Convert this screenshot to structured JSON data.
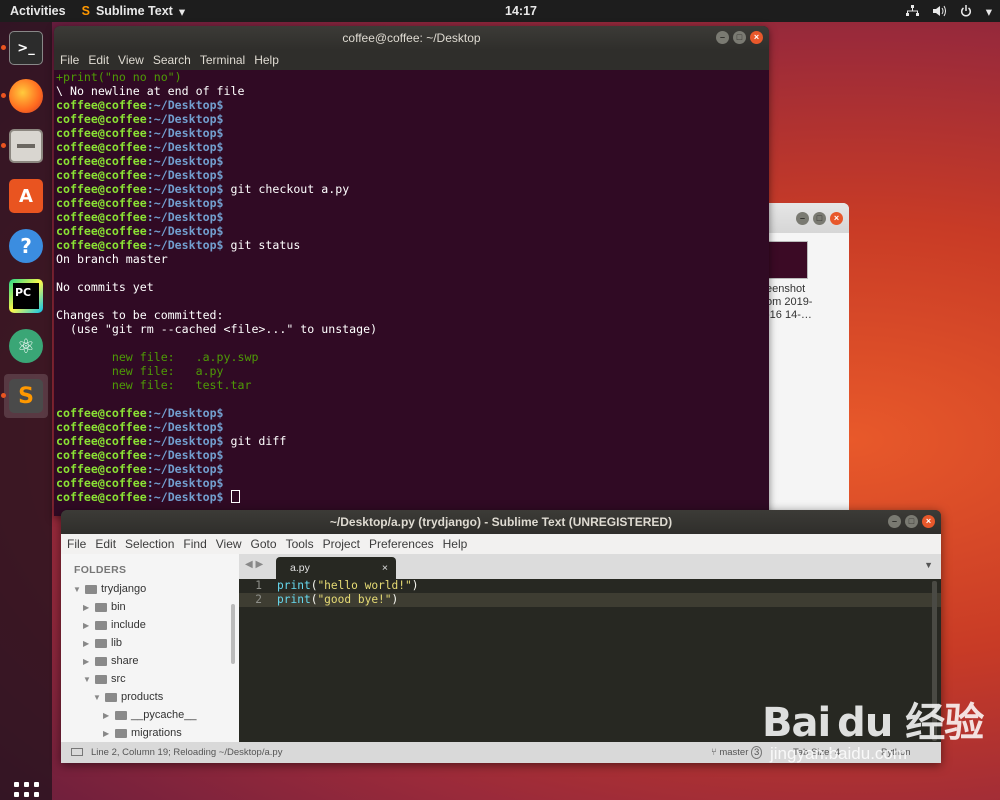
{
  "topbar": {
    "activities": "Activities",
    "app_name": "Sublime Text",
    "app_menu_arrow": "▾",
    "clock": "14:17"
  },
  "dock": {
    "items": [
      {
        "name": "terminal",
        "icon": "terminal-icon",
        "active": false,
        "running": true
      },
      {
        "name": "firefox",
        "icon": "firefox-icon",
        "active": false,
        "running": true
      },
      {
        "name": "files",
        "icon": "files-icon",
        "active": false,
        "running": true
      },
      {
        "name": "software",
        "icon": "ubuntu-software-icon",
        "active": false,
        "running": false
      },
      {
        "name": "help",
        "icon": "help-icon",
        "active": false,
        "running": false
      },
      {
        "name": "pycharm",
        "icon": "pycharm-icon",
        "active": false,
        "running": false
      },
      {
        "name": "atom",
        "icon": "atom-icon",
        "active": false,
        "running": false
      },
      {
        "name": "sublime",
        "icon": "sublime-text-icon",
        "active": true,
        "running": true
      }
    ]
  },
  "terminal": {
    "title": "coffee@coffee: ~/Desktop",
    "menu": [
      "File",
      "Edit",
      "View",
      "Search",
      "Terminal",
      "Help"
    ],
    "prompt_user": "coffee@coffee",
    "prompt_path": ":~/Desktop",
    "prompt_end": "$",
    "lines": [
      {
        "type": "diffadd",
        "text": "+print(\"no no no\")"
      },
      {
        "type": "text",
        "text": "\\ No newline at end of file"
      },
      {
        "type": "prompt",
        "cmd": ""
      },
      {
        "type": "prompt",
        "cmd": ""
      },
      {
        "type": "prompt",
        "cmd": ""
      },
      {
        "type": "prompt",
        "cmd": ""
      },
      {
        "type": "prompt",
        "cmd": ""
      },
      {
        "type": "prompt",
        "cmd": ""
      },
      {
        "type": "prompt",
        "cmd": " git checkout a.py"
      },
      {
        "type": "prompt",
        "cmd": ""
      },
      {
        "type": "prompt",
        "cmd": ""
      },
      {
        "type": "prompt",
        "cmd": ""
      },
      {
        "type": "prompt",
        "cmd": " git status"
      },
      {
        "type": "text",
        "text": "On branch master"
      },
      {
        "type": "text",
        "text": ""
      },
      {
        "type": "text",
        "text": "No commits yet"
      },
      {
        "type": "text",
        "text": ""
      },
      {
        "type": "text",
        "text": "Changes to be committed:"
      },
      {
        "type": "text",
        "text": "  (use \"git rm --cached <file>...\" to unstage)"
      },
      {
        "type": "text",
        "text": ""
      },
      {
        "type": "green",
        "text": "        new file:   .a.py.swp"
      },
      {
        "type": "green",
        "text": "        new file:   a.py"
      },
      {
        "type": "green",
        "text": "        new file:   test.tar"
      },
      {
        "type": "text",
        "text": ""
      },
      {
        "type": "prompt",
        "cmd": ""
      },
      {
        "type": "prompt",
        "cmd": ""
      },
      {
        "type": "prompt",
        "cmd": " git diff"
      },
      {
        "type": "prompt",
        "cmd": ""
      },
      {
        "type": "prompt",
        "cmd": ""
      },
      {
        "type": "prompt",
        "cmd": ""
      },
      {
        "type": "prompt",
        "cmd": "",
        "cursor": true
      }
    ]
  },
  "files_window": {
    "thumb_label": "eenshot\nom 2019-\n-16 14-…"
  },
  "sublime": {
    "title": "~/Desktop/a.py (trydjango) - Sublime Text (UNREGISTERED)",
    "menu": [
      "File",
      "Edit",
      "Selection",
      "Find",
      "View",
      "Goto",
      "Tools",
      "Project",
      "Preferences",
      "Help"
    ],
    "sidebar_header": "FOLDERS",
    "tree": [
      {
        "label": "trydjango",
        "depth": 0,
        "open": true
      },
      {
        "label": "bin",
        "depth": 1,
        "open": false
      },
      {
        "label": "include",
        "depth": 1,
        "open": false
      },
      {
        "label": "lib",
        "depth": 1,
        "open": false
      },
      {
        "label": "share",
        "depth": 1,
        "open": false
      },
      {
        "label": "src",
        "depth": 1,
        "open": true
      },
      {
        "label": "products",
        "depth": 2,
        "open": true
      },
      {
        "label": "__pycache__",
        "depth": 3,
        "open": false
      },
      {
        "label": "migrations",
        "depth": 3,
        "open": false
      }
    ],
    "tab": {
      "label": "a.py",
      "close": "×"
    },
    "code_lines": [
      {
        "num": "1",
        "fn": "print",
        "arg": "\"hello world!\"",
        "current": false
      },
      {
        "num": "2",
        "fn": "print",
        "arg": "\"good bye!\"",
        "current": true
      }
    ],
    "status": {
      "left": "Line 2, Column 19; Reloading ~/Desktop/a.py",
      "branch": "master",
      "branch_count": "3",
      "tab_size": "Tab Size: 4",
      "syntax": "Python"
    }
  },
  "watermark": {
    "big": "Bai du 经验",
    "small": "jingyan.baidu.com"
  },
  "colors": {
    "terminal_bg": "#300a24",
    "prompt_user": "#8ae234",
    "prompt_path": "#729fcf",
    "git_new_file": "#4e9a06",
    "ubuntu_orange": "#e95420",
    "editor_bg": "#272822",
    "string": "#e6db74",
    "builtin": "#66d9ef"
  }
}
